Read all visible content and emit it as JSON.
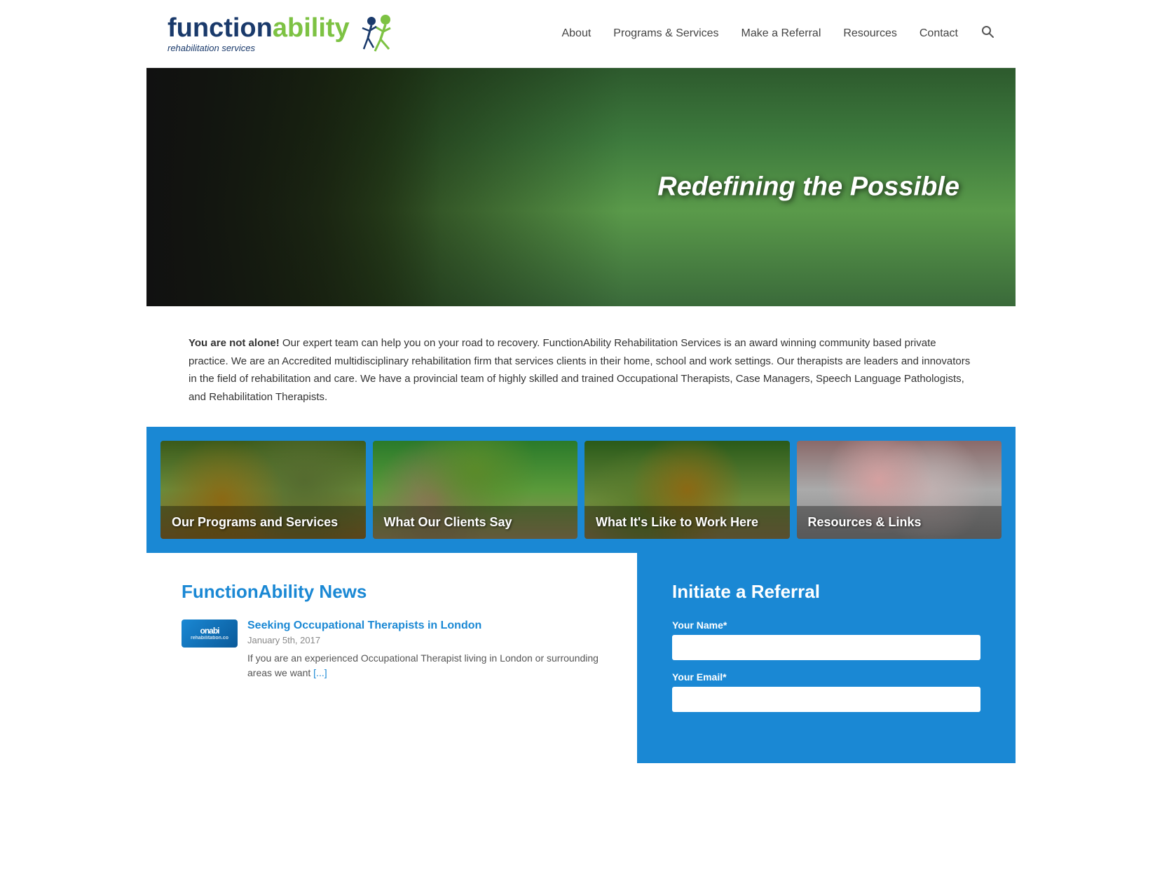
{
  "header": {
    "logo": {
      "function_text": "function",
      "ability_text": "ability",
      "sub_text": "rehabilitation services",
      "figure_symbol": "🏃"
    },
    "nav": {
      "items": [
        {
          "label": "About",
          "href": "#"
        },
        {
          "label": "Programs & Services",
          "href": "#"
        },
        {
          "label": "Make a Referral",
          "href": "#"
        },
        {
          "label": "Resources",
          "href": "#"
        },
        {
          "label": "Contact",
          "href": "#"
        }
      ]
    }
  },
  "hero": {
    "tagline": "Redefining the Possible"
  },
  "intro": {
    "bold_start": "You are not alone!",
    "text": " Our expert team can help you on your road to recovery. FunctionAbility Rehabilitation Services is an award winning community based private practice. We are an Accredited multidisciplinary rehabilitation firm that services clients in their home, school and work settings. Our therapists are leaders and innovators in the field of rehabilitation and care. We have a provincial team of highly skilled and trained Occupational Therapists, Case Managers, Speech Language Pathologists, and Rehabilitation Therapists."
  },
  "tiles": [
    {
      "label": "Our Programs and Services"
    },
    {
      "label": "What Our Clients Say"
    },
    {
      "label": "What It's Like to Work Here"
    },
    {
      "label": "Resources & Links"
    }
  ],
  "news": {
    "section_title": "FunctionAbility News",
    "items": [
      {
        "logo_line1": "onabi",
        "logo_line2": "rehabilitation.co",
        "link_text": "Seeking Occupational Therapists in London",
        "date": "January 5th, 2017",
        "excerpt": "If you are an experienced Occupational Therapist living in  London or surrounding areas we want",
        "more_label": "[...]"
      }
    ]
  },
  "referral": {
    "title": "Initiate a Referral",
    "fields": [
      {
        "label": "Your Name*",
        "placeholder": ""
      },
      {
        "label": "Your Email*",
        "placeholder": ""
      }
    ]
  }
}
